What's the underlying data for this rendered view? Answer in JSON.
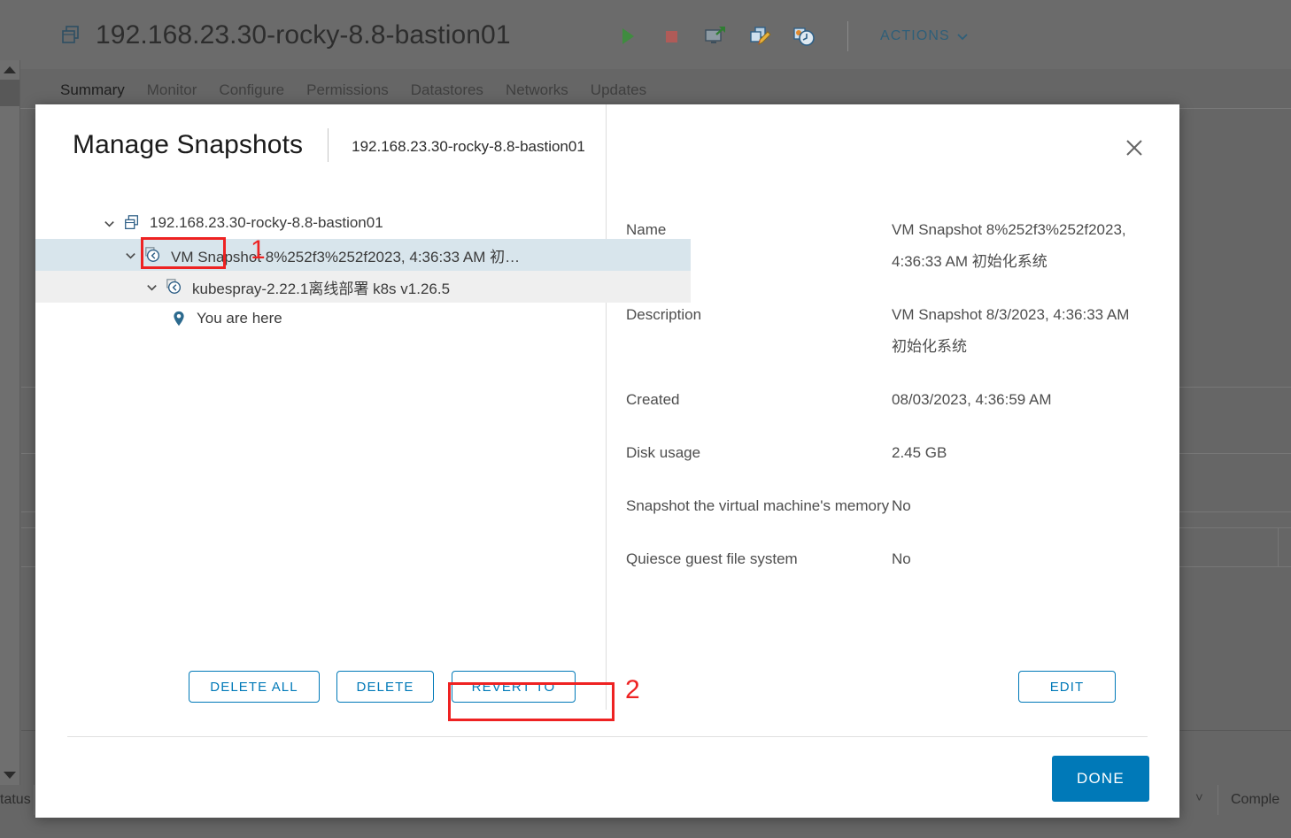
{
  "background": {
    "vm_title": "192.168.23.30-rocky-8.8-bastion01",
    "vm_icon": "virtual-machine-icon",
    "toolbar_icons": [
      {
        "name": "power-on-icon",
        "label": "Power On"
      },
      {
        "name": "power-off-icon",
        "label": "Power Off"
      },
      {
        "name": "launch-console-icon",
        "label": "Launch Web Console"
      },
      {
        "name": "edit-vm-icon",
        "label": "Edit Virtual Machine Settings"
      },
      {
        "name": "snapshot-icon",
        "label": "Snapshots"
      }
    ],
    "actions_label": "ACTIONS",
    "actions_caret": "chevron-down-icon",
    "tabs": [
      {
        "label": "Summary",
        "active": true
      },
      {
        "label": "Monitor",
        "active": false
      },
      {
        "label": "Configure",
        "active": false
      },
      {
        "label": "Permissions",
        "active": false
      },
      {
        "label": "Datastores",
        "active": false
      },
      {
        "label": "Networks",
        "active": false
      },
      {
        "label": "Updates",
        "active": false
      }
    ],
    "table_headers": {
      "left_partial": "tatus",
      "right_partial": "Comple"
    }
  },
  "modal": {
    "title": "Manage Snapshots",
    "subtitle": "192.168.23.30-rocky-8.8-bastion01",
    "close_icon": "close-icon",
    "tree": [
      {
        "label": "192.168.23.30-rocky-8.8-bastion01",
        "icon": "virtual-machine-icon",
        "caret": "chevron-down-icon",
        "indent": 0,
        "state": "normal"
      },
      {
        "label": "VM Snapshot 8%252f3%252f2023, 4:36:33 AM 初…",
        "icon": "snapshot-icon",
        "caret": "chevron-down-icon",
        "indent": 1,
        "state": "selected"
      },
      {
        "label": "kubespray-2.22.1离线部署 k8s v1.26.5",
        "icon": "snapshot-icon",
        "caret": "chevron-down-icon",
        "indent": 2,
        "state": "shaded"
      },
      {
        "label": "You are here",
        "icon": "location-pin-icon",
        "caret": "",
        "indent": 3,
        "state": "normal"
      }
    ],
    "details": [
      {
        "label": "Name",
        "value": "VM Snapshot 8%252f3%252f2023, 4:36:33 AM 初始化系统"
      },
      {
        "label": "Description",
        "value": "VM Snapshot 8/3/2023, 4:36:33 AM 初始化系统"
      },
      {
        "label": "Created",
        "value": "08/03/2023, 4:36:59 AM"
      },
      {
        "label": "Disk usage",
        "value": "2.45 GB"
      },
      {
        "label": "Snapshot the virtual machine's memory",
        "value": "No"
      },
      {
        "label": "Quiesce guest file system",
        "value": "No"
      }
    ],
    "buttons": {
      "delete_all": "DELETE ALL",
      "delete": "DELETE",
      "revert_to": "REVERT TO",
      "edit": "EDIT",
      "done": "DONE"
    }
  },
  "annotations": [
    {
      "number": "1",
      "target": "snapshot-node-icon"
    },
    {
      "number": "2",
      "target": "revert-to-button"
    }
  ],
  "colors": {
    "accent": "#0079b8",
    "annotation": "#ee2222",
    "selected_row": "#d8e5ec",
    "shaded_row": "#efefef",
    "backdrop": "#666666"
  }
}
